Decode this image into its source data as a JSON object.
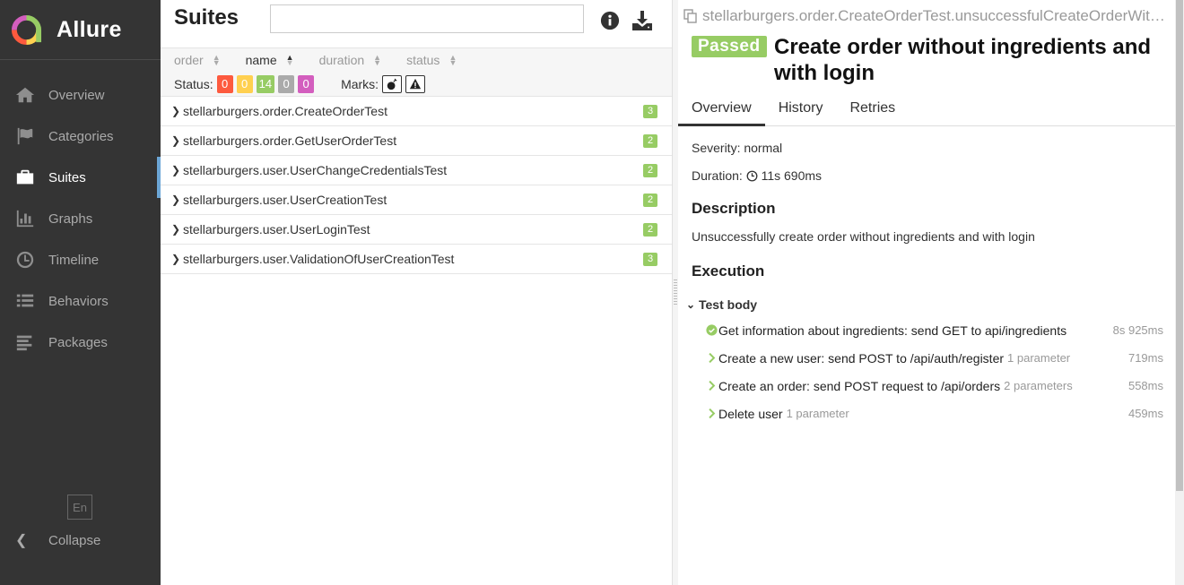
{
  "sidebar": {
    "brand": "Allure",
    "items": [
      {
        "label": "Overview",
        "icon": "home-icon"
      },
      {
        "label": "Categories",
        "icon": "flag-icon"
      },
      {
        "label": "Suites",
        "icon": "briefcase-icon"
      },
      {
        "label": "Graphs",
        "icon": "bar-chart-icon"
      },
      {
        "label": "Timeline",
        "icon": "clock-icon"
      },
      {
        "label": "Behaviors",
        "icon": "list-icon"
      },
      {
        "label": "Packages",
        "icon": "align-left-icon"
      }
    ],
    "active": "Suites",
    "language": "En",
    "collapse_label": "Collapse"
  },
  "suites_panel": {
    "title": "Suites",
    "search_value": "",
    "sort_columns": [
      "order",
      "name",
      "duration",
      "status"
    ],
    "sort_active": "name",
    "status_label": "Status:",
    "status_counts": {
      "failed": "0",
      "broken": "0",
      "passed": "14",
      "skipped": "0",
      "unknown": "0"
    },
    "marks_label": "Marks:",
    "rows": [
      {
        "name": "stellarburgers.order.CreateOrderTest",
        "count": "3"
      },
      {
        "name": "stellarburgers.order.GetUserOrderTest",
        "count": "2"
      },
      {
        "name": "stellarburgers.user.UserChangeCredentialsTest",
        "count": "2"
      },
      {
        "name": "stellarburgers.user.UserCreationTest",
        "count": "2"
      },
      {
        "name": "stellarburgers.user.UserLoginTest",
        "count": "2"
      },
      {
        "name": "stellarburgers.user.ValidationOfUserCreationTest",
        "count": "3"
      }
    ]
  },
  "testcase": {
    "path": "stellarburgers.order.CreateOrderTest.unsuccessfulCreateOrderWithoutIngredientsWithLogin",
    "status": "Passed",
    "title": "Create order without ingredients and with login",
    "tabs": [
      "Overview",
      "History",
      "Retries"
    ],
    "active_tab": "Overview",
    "severity": "Severity: normal",
    "duration_label": "Duration:",
    "duration": "11s 690ms",
    "description_heading": "Description",
    "description": "Unsuccessfully create order without ingredients and with login",
    "execution_heading": "Execution",
    "stage": "Test body",
    "steps": [
      {
        "name": "Get information about ingredients: send GET to api/ingredients",
        "params": "",
        "duration": "8s 925ms",
        "icon": "check-circle-icon"
      },
      {
        "name": "Create a new user: send POST to /api/auth/register",
        "params": "1 parameter",
        "duration": "719ms",
        "icon": "chevron-right-icon"
      },
      {
        "name": "Create an order: send POST request to /api/orders",
        "params": "2 parameters",
        "duration": "558ms",
        "icon": "chevron-right-icon"
      },
      {
        "name": "Delete user",
        "params": "1 parameter",
        "duration": "459ms",
        "icon": "chevron-right-icon"
      }
    ]
  },
  "colors": {
    "passed": "#97cc64",
    "failed": "#fd5a3e",
    "broken": "#ffd050",
    "skipped": "#aaaaaa",
    "unknown": "#d35ebe",
    "sidebar": "#343434",
    "accent": "#6ca6d6"
  }
}
